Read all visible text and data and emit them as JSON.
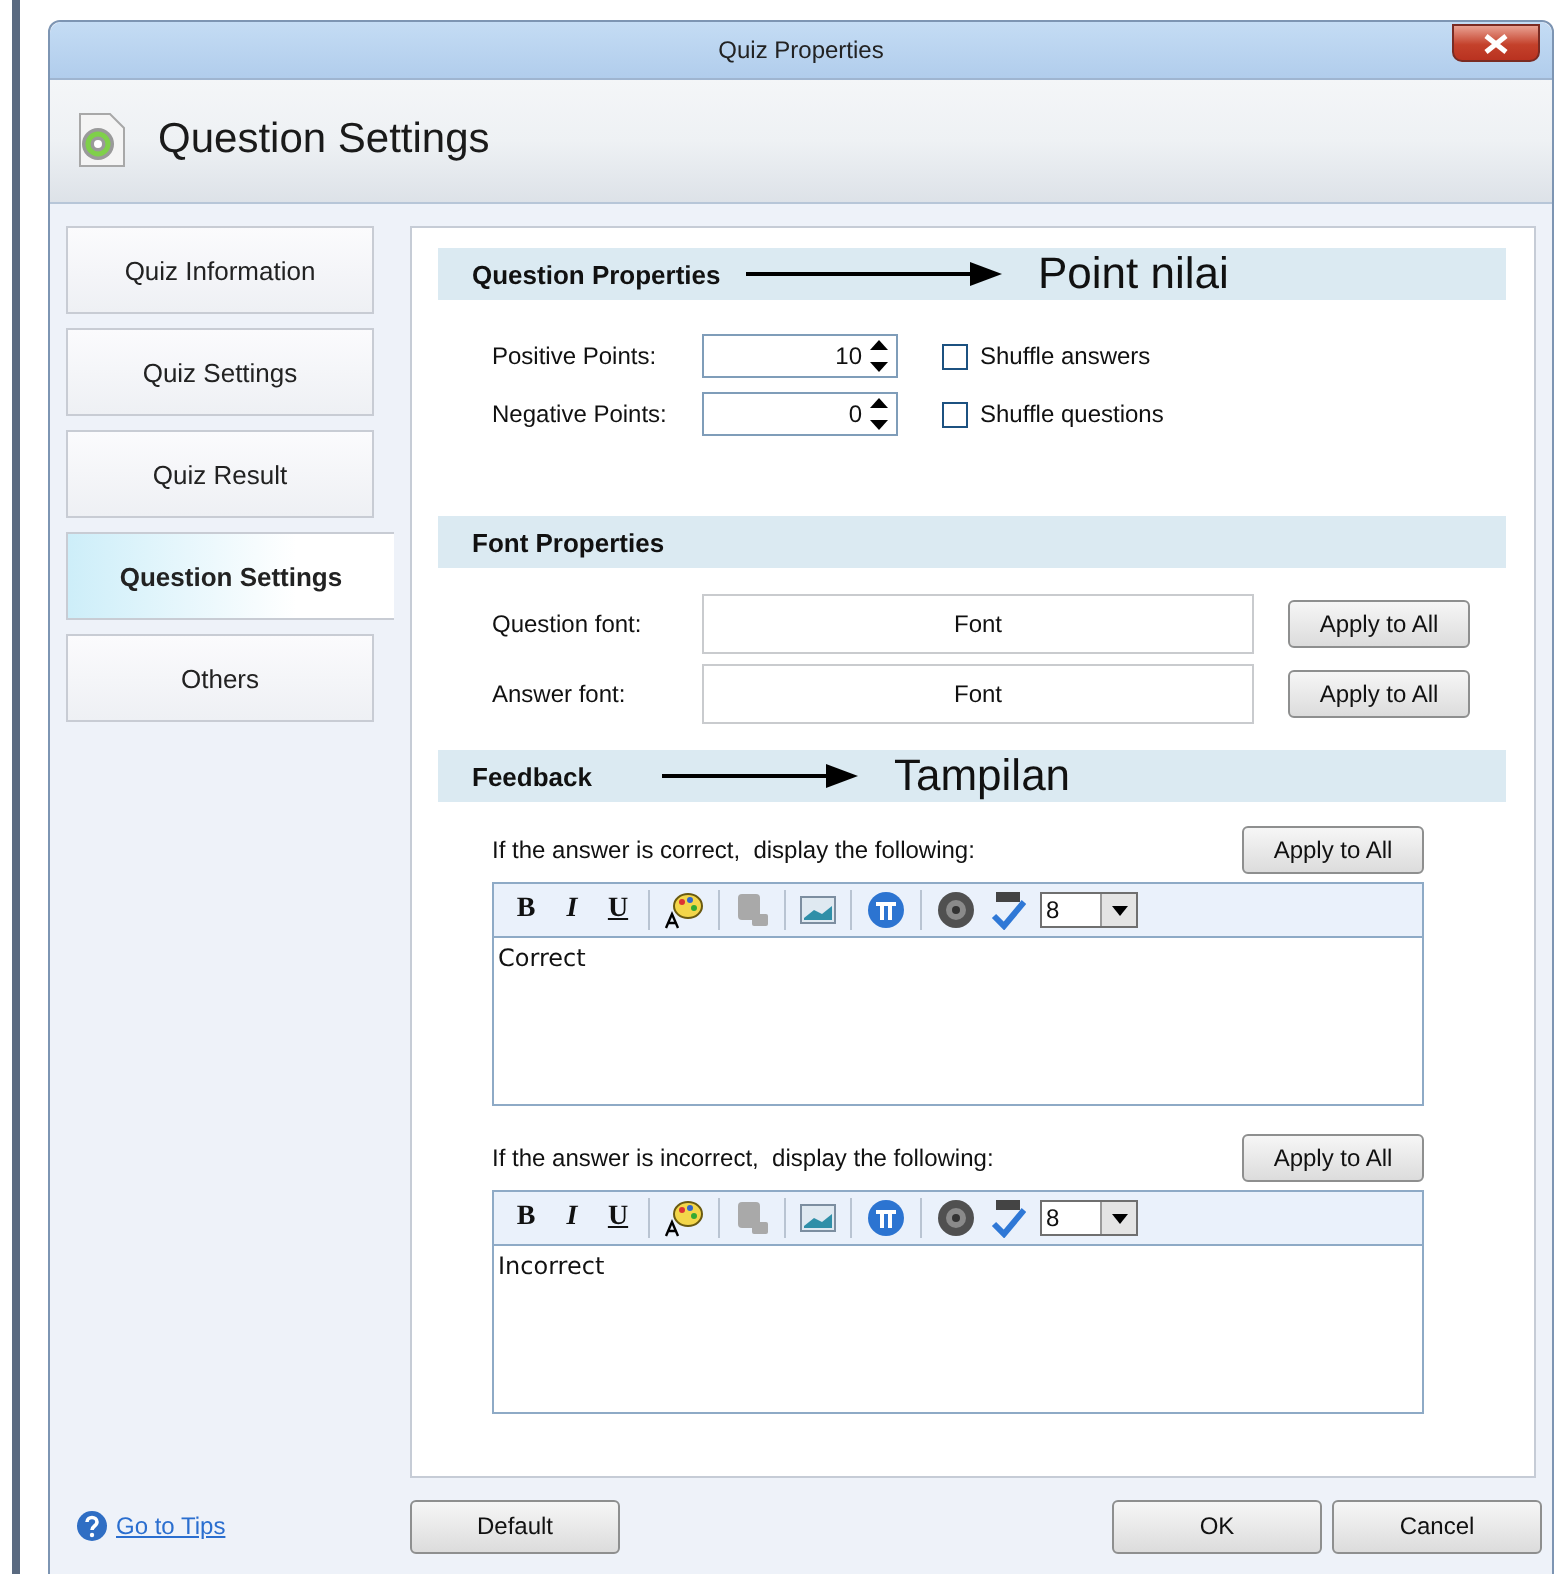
{
  "window": {
    "title": "Quiz Properties"
  },
  "header": {
    "title": "Question Settings"
  },
  "sidebar": {
    "items": [
      {
        "label": "Quiz Information",
        "selected": false
      },
      {
        "label": "Quiz Settings",
        "selected": false
      },
      {
        "label": "Quiz Result",
        "selected": false
      },
      {
        "label": "Question Settings",
        "selected": true
      },
      {
        "label": "Others",
        "selected": false
      }
    ]
  },
  "question_properties": {
    "title": "Question Properties",
    "annotation": "Point nilai",
    "fields": [
      {
        "label": "Positive Points:",
        "value": "10"
      },
      {
        "label": "Negative Points:",
        "value": "0"
      }
    ],
    "checkboxes": [
      {
        "label": "Shuffle answers",
        "checked": false
      },
      {
        "label": "Shuffle questions",
        "checked": false
      }
    ]
  },
  "font_properties": {
    "title": "Font Properties",
    "rows": [
      {
        "label": "Question font:",
        "value": "Font",
        "button": "Apply to All"
      },
      {
        "label": "Answer font:",
        "value": "Font",
        "button": "Apply to All"
      }
    ]
  },
  "feedback": {
    "title": "Feedback",
    "annotation": "Tampilan",
    "editors": [
      {
        "prompt": "If the answer is correct,  display the following:",
        "button": "Apply to All",
        "toolbar": [
          "B",
          "I",
          "U"
        ],
        "font_size": "8",
        "text": "Correct"
      },
      {
        "prompt": "If the answer is incorrect,  display the following:",
        "button": "Apply to All",
        "toolbar": [
          "B",
          "I",
          "U"
        ],
        "font_size": "8",
        "text": "Incorrect"
      }
    ]
  },
  "footer": {
    "tips_link": "Go to Tips",
    "buttons": [
      "Default",
      "OK",
      "Cancel"
    ]
  }
}
